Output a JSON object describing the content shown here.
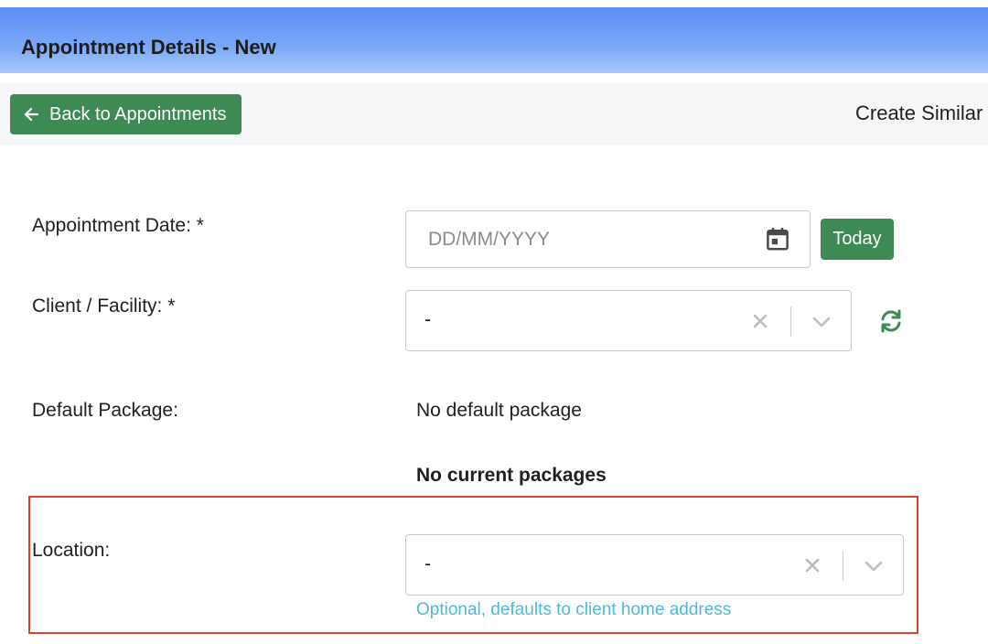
{
  "header": {
    "title": "Appointment Details - New"
  },
  "toolbar": {
    "back_label": "Back to Appointments",
    "create_similar_label": "Create Similar"
  },
  "form": {
    "appointment_date": {
      "label": "Appointment Date: *",
      "value": "",
      "placeholder": "DD/MM/YYYY",
      "today_label": "Today"
    },
    "client_facility": {
      "label": "Client / Facility: *",
      "value": "-"
    },
    "default_package": {
      "label": "Default Package:",
      "value": "No default package"
    },
    "current_packages": {
      "text": "No current packages"
    },
    "location": {
      "label": "Location:",
      "value": "-",
      "help": "Optional, defaults to client home address"
    }
  },
  "colors": {
    "header_gradient_top": "#5b8ef7",
    "header_gradient_bottom": "#a9c8fb",
    "primary_button": "#3e8a54",
    "refresh_icon": "#3e8a54",
    "help_text": "#4fb9db",
    "highlight_border": "#d9442f"
  },
  "icons": {
    "back": "arrow-left-icon",
    "date": "calendar-icon",
    "clear": "close-icon",
    "dropdown": "chevron-down-icon",
    "refresh": "refresh-icon"
  }
}
